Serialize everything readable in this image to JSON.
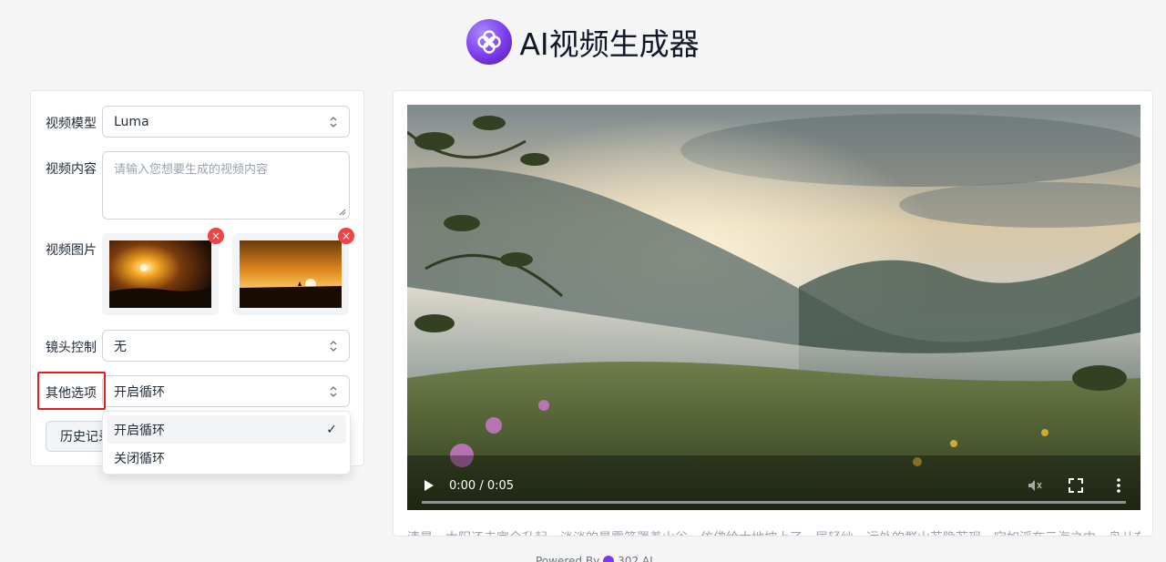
{
  "header": {
    "title": "AI视频生成器",
    "logo_icon": "flower-logo-icon"
  },
  "form": {
    "model": {
      "label": "视频模型",
      "value": "Luma"
    },
    "content": {
      "label": "视频内容",
      "placeholder": "请输入您想要生成的视频内容"
    },
    "images": {
      "label": "视频图片",
      "remove_symbol": "×"
    },
    "camera": {
      "label": "镜头控制",
      "value": "无"
    },
    "other": {
      "label": "其他选项",
      "value": "开启循环"
    },
    "history_button": "历史记录"
  },
  "dropdown": {
    "options": [
      "开启循环",
      "关闭循环"
    ],
    "selected": "开启循环",
    "check": "✓"
  },
  "video": {
    "time": "0:00 / 0:05",
    "caption": "清晨，太阳还未完全升起，淡淡的晨雾笼罩着山谷，仿佛给大地披上了一层轻纱。远处的群山若隐若现，宛如浮在云海之中。鸟儿在枝"
  },
  "footer": {
    "text": "Powered By",
    "brand": "302.AI"
  },
  "colors": {
    "accent": "#7c3aed",
    "remove": "#ef4444",
    "highlight": "#e11d1d"
  }
}
